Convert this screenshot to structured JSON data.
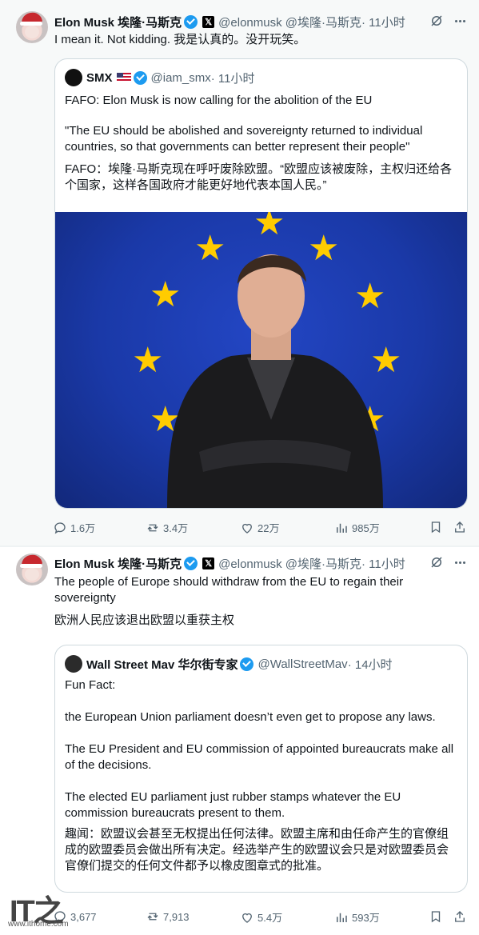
{
  "tweets": [
    {
      "author_name": "Elon Musk 埃隆·马斯克",
      "x_badge": "𝕏",
      "handle": "@elonmusk @埃隆·马斯克",
      "time": " · 11小时",
      "text": "I mean it. Not kidding. 我是认真的。没开玩笑。",
      "quote": {
        "author_name": "SMX",
        "handle": "@iam_smx",
        "time": " · 11小时",
        "line1": "FAFO: Elon Musk is now calling for the abolition of the EU",
        "line2": "\"The EU should be abolished and sovereignty returned to individual countries, so that governments can better represent their people\"",
        "line3": "FAFO：埃隆·马斯克现在呼吁废除欧盟。“欧盟应该被废除，主权归还给各个国家，这样各国政府才能更好地代表本国人民。”"
      },
      "stats": {
        "replies": "1.6万",
        "reposts": "3.4万",
        "likes": "22万",
        "views": "985万"
      }
    },
    {
      "author_name": "Elon Musk 埃隆·马斯克",
      "x_badge": "𝕏",
      "handle": "@elonmusk @埃隆·马斯克",
      "time": " · 11小时",
      "text_en": "The people of Europe should withdraw from the EU to regain their sovereignty",
      "text_zh": "欧洲人民应该退出欧盟以重获主权",
      "quote": {
        "author_name": "Wall Street Mav 华尔街专家",
        "handle": "@WallStreetMav",
        "time": " · 14小时",
        "line1": "Fun Fact:",
        "line2": "the European Union parliament doesn’t even get to propose any laws.",
        "line3": "The EU President and EU commission of appointed bureaucrats make all of the decisions.",
        "line4": "The elected EU parliament just rubber stamps whatever the EU commission bureaucrats present to them.",
        "line5": "趣闻：欧盟议会甚至无权提出任何法律。欧盟主席和由任命产生的官僚组成的欧盟委员会做出所有决定。经选举产生的欧盟议会只是对欧盟委员会官僚们提交的任何文件都予以橡皮图章式的批准。"
      },
      "stats": {
        "replies": "3,677",
        "reposts": "7,913",
        "likes": "5.4万",
        "views": "593万"
      }
    }
  ],
  "watermark": {
    "logo": "IT之家",
    "url": "www.ithome.com"
  },
  "colors": {
    "muted": "#536471",
    "verified": "#1d9bf0",
    "eu_blue": "#1a39a8",
    "eu_star": "#ffcc00"
  }
}
